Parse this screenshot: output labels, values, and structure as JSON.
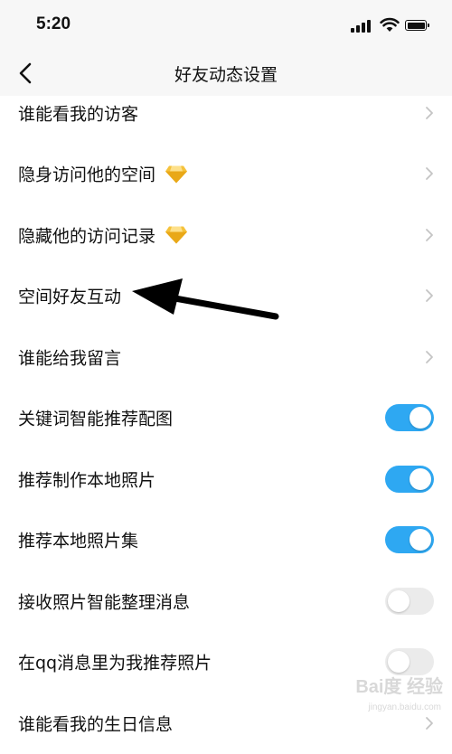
{
  "status_bar": {
    "time": "5:20"
  },
  "nav": {
    "title": "好友动态设置",
    "back_icon": "chevron-left-icon"
  },
  "settings": [
    {
      "label": "谁能看我的访客",
      "control": "chevron"
    },
    {
      "label": "隐身访问他的空间",
      "control": "chevron",
      "badge": "diamond-icon"
    },
    {
      "label": "隐藏他的访问记录",
      "control": "chevron",
      "badge": "diamond-icon"
    },
    {
      "label": "空间好友互动",
      "control": "chevron"
    },
    {
      "label": "谁能给我留言",
      "control": "chevron"
    },
    {
      "label": "关键词智能推荐配图",
      "control": "toggle",
      "on": true
    },
    {
      "label": "推荐制作本地照片",
      "control": "toggle",
      "on": true
    },
    {
      "label": "推荐本地照片集",
      "control": "toggle",
      "on": true
    },
    {
      "label": "接收照片智能整理消息",
      "control": "toggle",
      "on": false
    },
    {
      "label": "在qq消息里为我推荐照片",
      "control": "toggle",
      "on": false
    },
    {
      "label": "谁能看我的生日信息",
      "control": "chevron"
    }
  ],
  "watermark": {
    "text": "Bai度 经验",
    "sub": "jingyan.baidu.com"
  },
  "colors": {
    "toggle_on": "#2ea8f2",
    "toggle_off": "#ebebeb",
    "diamond": "#f5c23b",
    "chevron": "#c4c4c4"
  }
}
